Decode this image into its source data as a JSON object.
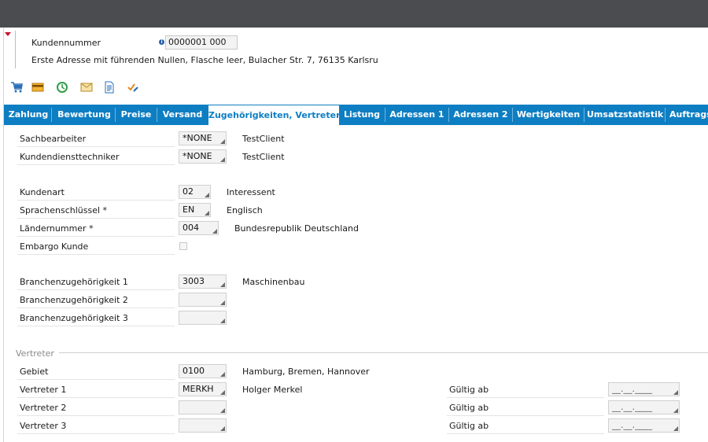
{
  "header": {
    "customer_number_label": "Kundennummer",
    "customer_number_value": "0000001 000",
    "address_line": "Erste Adresse mit führenden Nullen, Flasche leer, Bulacher Str. 7, 76135 Karlsru"
  },
  "toolbar": {
    "icons": [
      "cart-icon",
      "card-icon",
      "history-icon",
      "mail-icon",
      "document-icon",
      "check-edit-icon"
    ]
  },
  "tabs": [
    {
      "label": "Zahlung"
    },
    {
      "label": "Bewertung"
    },
    {
      "label": "Preise"
    },
    {
      "label": "Versand"
    },
    {
      "label": "Zugehörigkeiten, Vertreter",
      "active": true
    },
    {
      "label": "Listung"
    },
    {
      "label": "Adressen 1"
    },
    {
      "label": "Adressen 2"
    },
    {
      "label": "Wertigkeiten"
    },
    {
      "label": "Umsatzstatistik"
    },
    {
      "label": "Auftrags"
    }
  ],
  "form": {
    "sachbearbeiter": {
      "label": "Sachbearbeiter",
      "value": "*NONE",
      "desc": "TestClient"
    },
    "kundendiensttechniker": {
      "label": "Kundendiensttechniker",
      "value": "*NONE",
      "desc": "TestClient"
    },
    "kundenart": {
      "label": "Kundenart",
      "value": "02",
      "desc": "Interessent"
    },
    "sprachenschluessel": {
      "label": "Sprachenschlüssel *",
      "value": "EN",
      "desc": "Englisch"
    },
    "laendernummer": {
      "label": "Ländernummer *",
      "value": "004",
      "desc": "Bundesrepublik Deutschland"
    },
    "embargo": {
      "label": "Embargo Kunde"
    },
    "branche1": {
      "label": "Branchenzugehörigkeit 1",
      "value": "3003",
      "desc": "Maschinenbau"
    },
    "branche2": {
      "label": "Branchenzugehörigkeit 2",
      "value": ""
    },
    "branche3": {
      "label": "Branchenzugehörigkeit 3",
      "value": ""
    }
  },
  "vertreter_section": {
    "title": "Vertreter",
    "gebiet": {
      "label": "Gebiet",
      "value": "0100",
      "desc": "Hamburg, Bremen, Hannover"
    },
    "vertreter1": {
      "label": "Vertreter 1",
      "value": "MERKH",
      "desc": "Holger Merkel"
    },
    "vertreter2": {
      "label": "Vertreter 2",
      "value": ""
    },
    "vertreter3": {
      "label": "Vertreter 3",
      "value": ""
    },
    "gueltig_label": "Gültig ab",
    "date_placeholder": "__.__.____"
  },
  "colors": {
    "tab_bar": "#0e7ec3",
    "top_bar": "#4a4c50",
    "accent_red": "#c8102e"
  }
}
